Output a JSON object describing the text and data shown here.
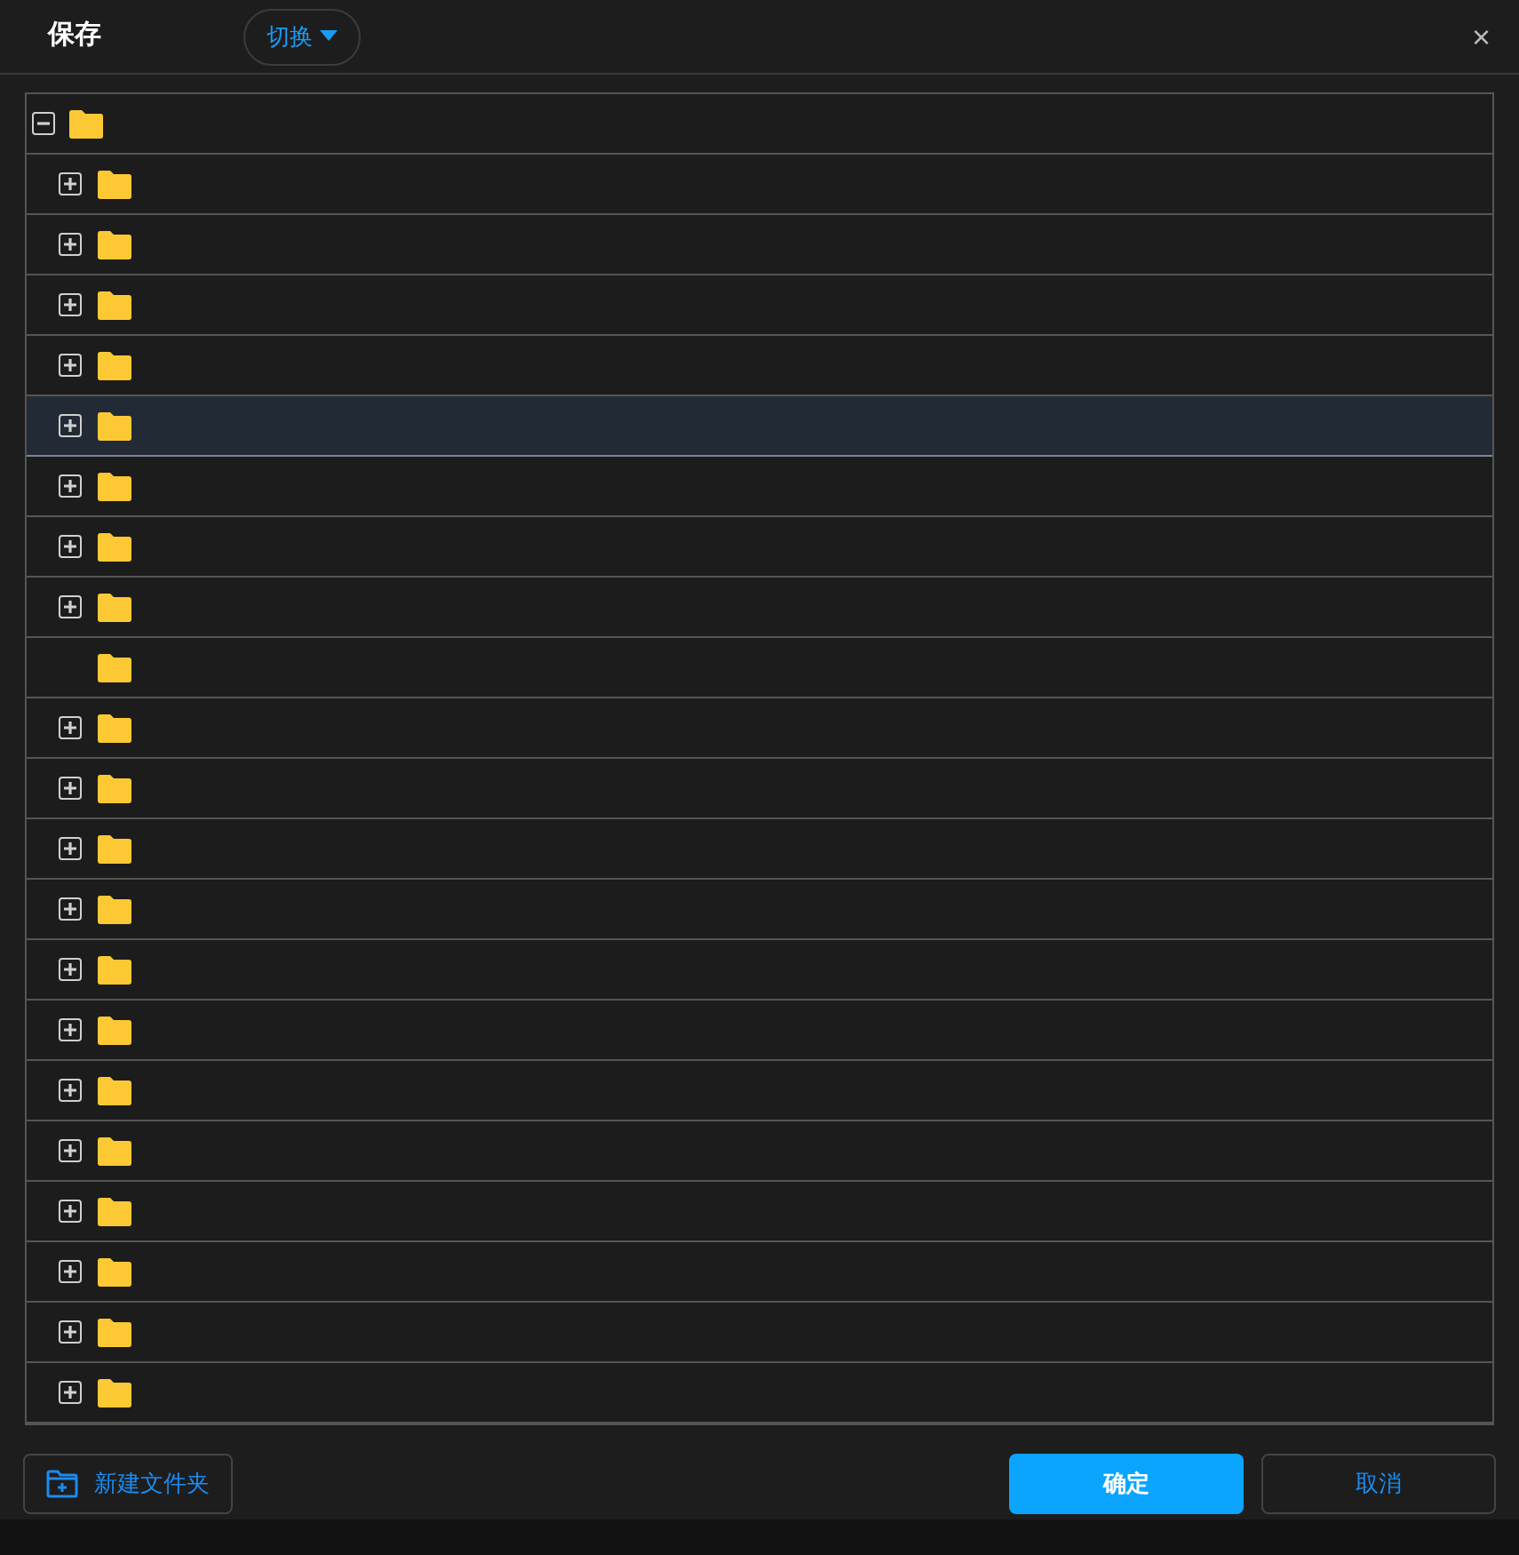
{
  "dialog": {
    "title": "保存",
    "switch_button": "切换",
    "close": "×"
  },
  "tree": {
    "expanded": true,
    "selected": false,
    "children": [
      {
        "expandable": true,
        "selected": false
      },
      {
        "expandable": true,
        "selected": false
      },
      {
        "expandable": true,
        "selected": false
      },
      {
        "expandable": true,
        "selected": false
      },
      {
        "expandable": true,
        "selected": true
      },
      {
        "expandable": true,
        "selected": false
      },
      {
        "expandable": true,
        "selected": false
      },
      {
        "expandable": true,
        "selected": false
      },
      {
        "expandable": false,
        "selected": false
      },
      {
        "expandable": true,
        "selected": false
      },
      {
        "expandable": true,
        "selected": false
      },
      {
        "expandable": true,
        "selected": false
      },
      {
        "expandable": true,
        "selected": false
      },
      {
        "expandable": true,
        "selected": false
      },
      {
        "expandable": true,
        "selected": false
      },
      {
        "expandable": true,
        "selected": false
      },
      {
        "expandable": true,
        "selected": false
      },
      {
        "expandable": true,
        "selected": false
      },
      {
        "expandable": true,
        "selected": false
      },
      {
        "expandable": true,
        "selected": false
      },
      {
        "expandable": true,
        "selected": false
      }
    ]
  },
  "footer": {
    "new_folder": "新建文件夹",
    "ok": "确定",
    "cancel": "取消"
  }
}
